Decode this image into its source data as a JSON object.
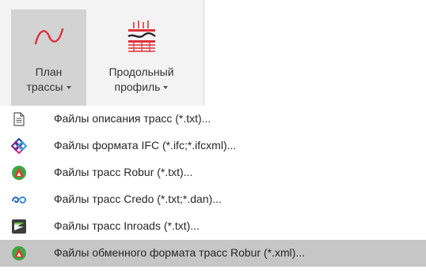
{
  "ribbon": {
    "plan_button": {
      "line1": "План",
      "line2": "трассы",
      "icon": "route-curve-icon"
    },
    "profile_button": {
      "line1": "Продольный",
      "line2": "профиль",
      "icon": "longitudinal-profile-icon"
    }
  },
  "menu": {
    "items": [
      {
        "label": "Файлы описания трасс (*.txt)...",
        "icon": "text-file-icon"
      },
      {
        "label": "Файлы формата IFC (*.ifc;*.ifcxml)...",
        "icon": "ifc-logo-icon"
      },
      {
        "label": "Файлы трасс Robur (*.txt)...",
        "icon": "robur-logo-icon"
      },
      {
        "label": "Файлы трасс Credo (*.txt;*.dan)...",
        "icon": "credo-logo-icon"
      },
      {
        "label": "Файлы трасс Inroads (*.txt)...",
        "icon": "inroads-logo-icon"
      },
      {
        "label": "Файлы обменного формата трасс Robur (*.xml)...",
        "icon": "robur-logo-icon",
        "highlighted": true
      }
    ]
  },
  "colors": {
    "ribbon_bg": "#f3f3f3",
    "pressed_button_bg": "#d3d3d3",
    "highlight_bg": "#c6c6c6",
    "route_curve": "#e0303a"
  }
}
